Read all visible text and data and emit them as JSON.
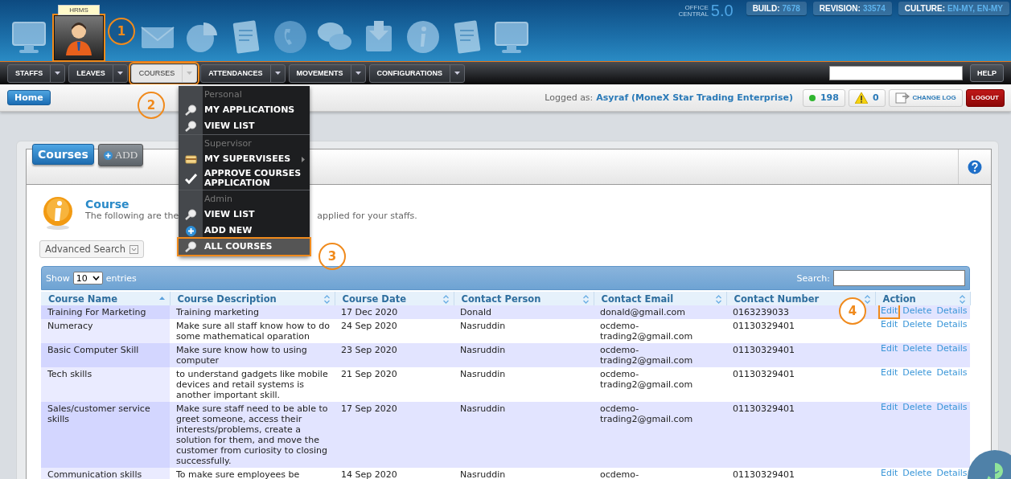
{
  "header": {
    "apps": [
      {
        "kind": "monitor",
        "selected": false,
        "highlighted": false
      },
      {
        "kind": "person",
        "selected": true,
        "highlighted": true,
        "tooltip": "HRMS"
      },
      {
        "kind": "envelope",
        "selected": false,
        "highlighted": false
      },
      {
        "kind": "pie",
        "selected": false,
        "highlighted": false
      },
      {
        "kind": "document",
        "selected": false,
        "highlighted": false
      },
      {
        "kind": "phone",
        "selected": false,
        "highlighted": false
      },
      {
        "kind": "chat",
        "selected": false,
        "highlighted": false
      },
      {
        "kind": "inbox",
        "selected": false,
        "highlighted": false
      },
      {
        "kind": "info",
        "selected": false,
        "highlighted": false
      },
      {
        "kind": "document",
        "selected": false,
        "highlighted": false
      },
      {
        "kind": "monitor",
        "selected": false,
        "highlighted": false
      }
    ],
    "product": {
      "line1": "OFFICE",
      "line2": "CENTRAL",
      "version": "5.0"
    },
    "info_badges": [
      {
        "label": "BUILD:",
        "value": "7678"
      },
      {
        "label": "REVISION:",
        "value": "33574"
      },
      {
        "label": "CULTURE:",
        "value": "EN-MY, EN-MY"
      }
    ]
  },
  "nav": {
    "items": [
      {
        "label": "STAFFS",
        "selected": false,
        "highlighted": false
      },
      {
        "label": "LEAVES",
        "selected": false,
        "highlighted": false
      },
      {
        "label": "COURSES",
        "selected": true,
        "highlighted": true
      },
      {
        "label": "ATTENDANCES",
        "selected": false,
        "highlighted": false
      },
      {
        "label": "MOVEMENTS",
        "selected": false,
        "highlighted": false
      },
      {
        "label": "CONFIGURATIONS",
        "selected": false,
        "highlighted": false
      }
    ],
    "help_button": "HELP"
  },
  "subbar": {
    "home": "Home",
    "logged_as_label": "Logged as:",
    "user": "Asyraf (MoneX Star Trading Enterprise)",
    "counters": [
      {
        "kind": "online",
        "value": "198"
      },
      {
        "kind": "warning",
        "value": "0"
      }
    ],
    "change_log": "CHANGE LOG",
    "logout": "LOGOUT"
  },
  "dropdown": {
    "sections": [
      {
        "heading": "Personal",
        "items": [
          {
            "label": "MY APPLICATIONS",
            "kind": "search",
            "submenu": false,
            "highlighted": false
          },
          {
            "label": "VIEW LIST",
            "kind": "search",
            "submenu": false,
            "highlighted": false
          }
        ]
      },
      {
        "heading": "Supervisor",
        "items": [
          {
            "label": "MY SUPERVISEES",
            "kind": "card",
            "submenu": true,
            "highlighted": false
          },
          {
            "label": "APPROVE COURSES APPLICATION",
            "kind": "check",
            "submenu": false,
            "highlighted": false
          }
        ]
      },
      {
        "heading": "Admin",
        "items": [
          {
            "label": "VIEW LIST",
            "kind": "search",
            "submenu": false,
            "highlighted": false
          },
          {
            "label": "ADD NEW",
            "kind": "add",
            "submenu": false,
            "highlighted": false
          },
          {
            "label": "ALL COURSES",
            "kind": "search",
            "submenu": false,
            "highlighted": true
          }
        ]
      }
    ]
  },
  "panel": {
    "tabs": [
      {
        "label": "Courses",
        "selected": true
      }
    ],
    "add_button": "ADD",
    "info": {
      "title": "Course",
      "description_parts": [
        "The following are the",
        "applied for your staffs."
      ]
    },
    "advanced_search": "Advanced Search",
    "table": {
      "length_before": "Show",
      "length_value": "10",
      "length_after": "entries",
      "search_label": "Search:",
      "columns": [
        {
          "label": "Course Name",
          "sorted": true
        },
        {
          "label": "Course Description",
          "sorted": false
        },
        {
          "label": "Course Date",
          "sorted": false
        },
        {
          "label": "Contact Person",
          "sorted": false
        },
        {
          "label": "Contact Email",
          "sorted": false
        },
        {
          "label": "Contact Number",
          "sorted": false
        },
        {
          "label": "Action",
          "sorted": false
        }
      ],
      "rows": [
        {
          "cells": [
            "Training For Marketing",
            "Training marketing",
            "17 Dec 2020",
            "Donald",
            "donald@gmail.com",
            "0163239033"
          ],
          "actions": [
            {
              "label": "Edit",
              "highlighted": true
            },
            {
              "label": "Delete",
              "highlighted": false
            },
            {
              "label": "Details",
              "highlighted": false
            }
          ]
        },
        {
          "cells": [
            "Numeracy",
            "Make sure all staff know how to do some mathematical oparation",
            "24 Sep 2020",
            "Nasruddin",
            "ocdemo-trading2@gmail.com",
            "01130329401"
          ],
          "actions": [
            {
              "label": "Edit",
              "highlighted": false
            },
            {
              "label": "Delete",
              "highlighted": false
            },
            {
              "label": "Details",
              "highlighted": false
            }
          ]
        },
        {
          "cells": [
            "Basic Computer Skill",
            "Make sure know how to using computer",
            "23 Sep 2020",
            "Nasruddin",
            "ocdemo-trading2@gmail.com",
            "01130329401"
          ],
          "actions": [
            {
              "label": "Edit",
              "highlighted": false
            },
            {
              "label": "Delete",
              "highlighted": false
            },
            {
              "label": "Details",
              "highlighted": false
            }
          ]
        },
        {
          "cells": [
            "Tech skills",
            "to understand gadgets like mobile devices and retail systems is another important skill.",
            "21 Sep 2020",
            "Nasruddin",
            "ocdemo-trading2@gmail.com",
            "01130329401"
          ],
          "actions": [
            {
              "label": "Edit",
              "highlighted": false
            },
            {
              "label": "Delete",
              "highlighted": false
            },
            {
              "label": "Details",
              "highlighted": false
            }
          ]
        },
        {
          "cells": [
            "Sales/customer service skills",
            "Make sure staff need to be able to greet someone, access their interests/problems, create a solution for them, and move the customer from curiosity to closing successfully.",
            "17 Sep 2020",
            "Nasruddin",
            "ocdemo-trading2@gmail.com",
            "01130329401"
          ],
          "actions": [
            {
              "label": "Edit",
              "highlighted": false
            },
            {
              "label": "Delete",
              "highlighted": false
            },
            {
              "label": "Details",
              "highlighted": false
            }
          ]
        },
        {
          "cells": [
            "Communication skills",
            "To make sure employees be",
            "14 Sep 2020",
            "Nasruddin",
            "ocdemo-",
            "01130329401"
          ],
          "actions": [
            {
              "label": "Edit",
              "highlighted": false
            },
            {
              "label": "Delete",
              "highlighted": false
            },
            {
              "label": "Details",
              "highlighted": false
            }
          ]
        }
      ]
    }
  },
  "callouts": [
    {
      "number": "1"
    },
    {
      "number": "2"
    },
    {
      "number": "3"
    },
    {
      "number": "4"
    }
  ]
}
